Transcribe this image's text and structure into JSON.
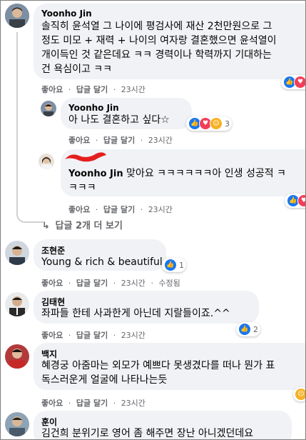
{
  "comments": [
    {
      "author": "Yoonho Jin",
      "lines": [
        "솔직히 윤석열 그 나이에 평검사에 재산 2천만원으로 그",
        "정도 미모 + 재력 + 나이의 여자랑 결혼했으면 윤석열이",
        "개이득인 것 같은데요 ㅋㅋ 경력이나 학력까지 기대하는",
        "건 욕심이고 ㅋㅋ"
      ],
      "like": "좋아요",
      "reply": "답글 달기",
      "time": "23시간",
      "reaction_count": "2"
    },
    {
      "author": "Yoonho Jin",
      "lines": [
        "아 나도 결혼하고 싶다☆"
      ],
      "like": "좋아요",
      "reply": "답글 달기",
      "time": "23시간",
      "reaction_count": "3"
    },
    {
      "author_prefix": "Yoonho Jin",
      "lines": [
        " 맞아요 ㅋㅋㅋㅋㅋㅋ아 인생 성공적 ㅋ",
        "ㅋㅋㅋ"
      ],
      "like": "좋아요",
      "reply": "답글 달기",
      "time": "23시간",
      "reaction_count": "2"
    },
    {
      "author": "조현준",
      "lines": [
        "Young & rich & beautiful"
      ],
      "like": "좋아요",
      "reply": "답글 달기",
      "time": "23시간",
      "edited": "수정됨",
      "reaction_count": "1"
    },
    {
      "author": "김태현",
      "lines": [
        "좌파들 한테 사과한게 아닌데 지랄들이죠.^^"
      ],
      "like": "좋아요",
      "reply": "답글 달기",
      "time": "23시간",
      "reaction_count": "2"
    },
    {
      "author": "백지",
      "lines": [
        "혜경궁 아줌마는 외모가 예쁘다 못생겼다를 떠나 뭔가 표",
        "독스러운게 얼굴에 나타나는듯"
      ],
      "like": "좋아요",
      "reply": "답글 달기",
      "time": "23시간"
    },
    {
      "author": "훈이",
      "lines": [
        "김건희 분위기로 영어 좀 해주면 장난 아니겠던데요"
      ]
    }
  ],
  "more_replies": "답글 2개 더 보기",
  "separator": "·",
  "colors": {
    "bubble": "#f0f2f5",
    "meta": "#65676b",
    "like_blue": "#1877f2",
    "love_red": "#f33e58",
    "haha_yellow": "#f7b125",
    "redaction": "#e41e1e"
  },
  "icons": [
    "like-icon",
    "love-icon",
    "haha-icon",
    "sad-icon",
    "reply-arrow-icon"
  ]
}
